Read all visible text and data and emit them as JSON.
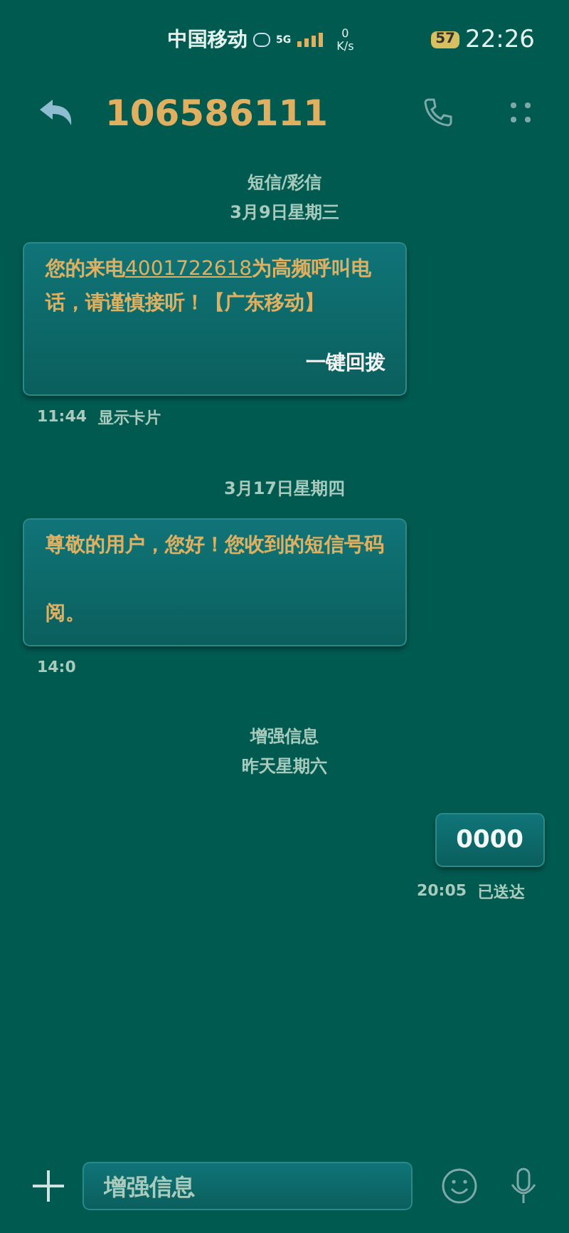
{
  "status_bar": {
    "carrier": "中国移动",
    "network": "5G",
    "speed_value": "0",
    "speed_unit": "K/s",
    "battery": "57",
    "time": "22:26"
  },
  "header": {
    "title": "106586111"
  },
  "thread": [
    {
      "kind": "divider",
      "lines": [
        "短信/彩信",
        "3月9日星期三"
      ]
    },
    {
      "kind": "incoming",
      "text": "您的来电**4001722618**为高频呼叫电话，请谨慎接听！【广东移动】",
      "action": "一键回拨",
      "time": "11:44",
      "meta": "显示卡片"
    },
    {
      "kind": "divider",
      "lines": [
        "3月17日星期四"
      ]
    },
    {
      "kind": "incoming",
      "lines": [
        "尊敬的用户，您好！您收到的短信号码",
        "阅。"
      ],
      "time": "14:0"
    },
    {
      "kind": "divider",
      "lines": [
        "增强信息",
        "昨天星期六"
      ]
    },
    {
      "kind": "outgoing",
      "text": "0000",
      "time": "20:05",
      "meta": "已送达"
    }
  ],
  "composer": {
    "placeholder": "增强信息"
  }
}
